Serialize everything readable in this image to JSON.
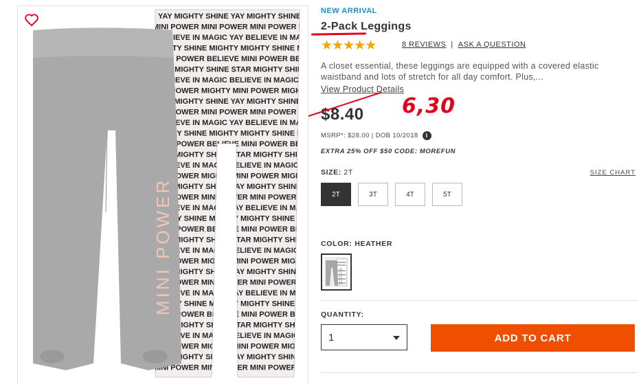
{
  "product": {
    "badge": "NEW ARRIVAL",
    "title": "2-Pack Leggings",
    "rating": 4.5,
    "stars_text": "★★★★★",
    "reviews_label": "8 REVIEWS",
    "question_label": "ASK A QUESTION",
    "description": "A closet essential, these leggings are equipped with a covered elastic waistband and lots of stretch for all day comfort. Plus,...",
    "view_details": "View Product Details",
    "price": "$8.40",
    "handwritten_price": "6,30",
    "msrp": "MSRP*: $28.00 | DOB 10/2018",
    "info_icon": "i",
    "promo": "EXTRA 25% OFF $50 CODE: MOREFUN"
  },
  "size": {
    "label": "SIZE:",
    "selected": "2T",
    "chart_label": "SIZE CHART",
    "options": [
      "2T",
      "3T",
      "4T",
      "5T"
    ]
  },
  "color": {
    "label": "COLOR: HEATHER"
  },
  "quantity": {
    "label": "QUANTITY:",
    "value": "1"
  },
  "cart": {
    "label": "ADD TO CART"
  },
  "image": {
    "print_lines": [
      "YAY  MIGHTY  SHINE",
      "MINI POWER  MINI POWER",
      "BELIEVE IN MAGIC  YAY",
      "MIGHTY  SHINE  MIGHTY",
      "MINI POWER  BELIEVE",
      "STAR  MIGHTY  SHINE",
      "BELIEVE IN MAGIC",
      "MINI POWER  MIGHTY"
    ],
    "leg_print": "MINI POWER"
  },
  "colors": {
    "accent_blue": "#1d8ed1",
    "cart_orange": "#f04e00",
    "annotation_red": "#e3001b",
    "star_gold": "#f0a500"
  }
}
